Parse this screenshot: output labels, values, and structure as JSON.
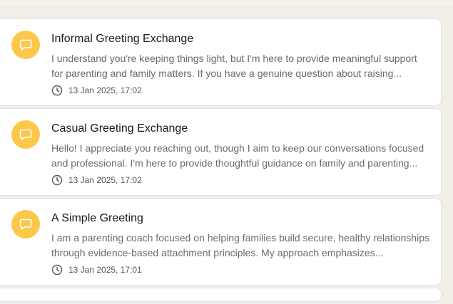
{
  "conversations": [
    {
      "title": "Informal Greeting Exchange",
      "excerpt": "I understand you're keeping things light, but I'm here to provide meaningful support for parenting and family matters. If you have a genuine question about raising...",
      "timestamp": "13 Jan 2025, 17:02",
      "icon": "chat-bubble-icon"
    },
    {
      "title": "Casual Greeting Exchange",
      "excerpt": "Hello! I appreciate you reaching out, though I aim to keep our conversations focused and professional. I'm here to provide thoughtful guidance on family and parenting...",
      "timestamp": "13 Jan 2025, 17:02",
      "icon": "chat-bubble-icon"
    },
    {
      "title": "A Simple Greeting",
      "excerpt": "I am a parenting coach focused on helping families build secure, healthy relationships through evidence-based attachment principles. My approach emphasizes...",
      "timestamp": "13 Jan 2025, 17:01",
      "icon": "chat-bubble-icon"
    }
  ],
  "colors": {
    "page_background": "#f1efe7",
    "card_background": "#ffffff",
    "avatar": "#fcc84a"
  }
}
